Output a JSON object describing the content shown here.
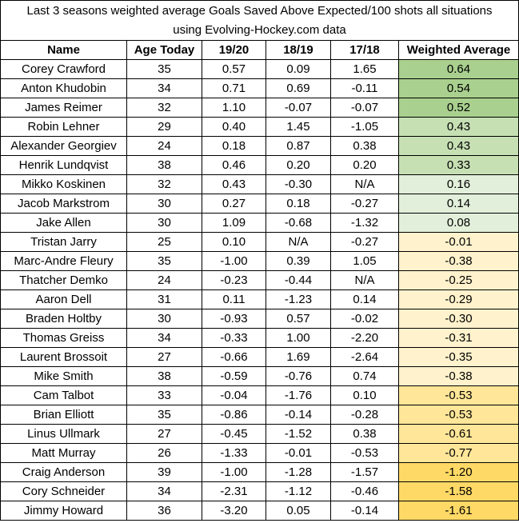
{
  "title": {
    "line1": "Last 3 seasons weighted average Goals Saved Above Expected/100 shots all situations",
    "line2": "using Evolving-Hockey.com data"
  },
  "columns": [
    "Name",
    "Age Today",
    "19/20",
    "18/19",
    "17/18",
    "Weighted Average"
  ],
  "colors": {
    "green_strong": "#a9d08e",
    "green_mid": "#c6e0b4",
    "green_light": "#e2efda",
    "yellow_light": "#fff2cc",
    "yellow_mid": "#ffe699",
    "yellow_strong": "#ffd966"
  },
  "rows": [
    {
      "name": "Corey Crawford",
      "age": "35",
      "s1920": "0.57",
      "s1819": "0.09",
      "s1718": "1.65",
      "wavg": "0.64",
      "shade": "green_strong"
    },
    {
      "name": "Anton Khudobin",
      "age": "34",
      "s1920": "0.71",
      "s1819": "0.69",
      "s1718": "-0.11",
      "wavg": "0.54",
      "shade": "green_strong"
    },
    {
      "name": "James Reimer",
      "age": "32",
      "s1920": "1.10",
      "s1819": "-0.07",
      "s1718": "-0.07",
      "wavg": "0.52",
      "shade": "green_strong"
    },
    {
      "name": "Robin Lehner",
      "age": "29",
      "s1920": "0.40",
      "s1819": "1.45",
      "s1718": "-1.05",
      "wavg": "0.43",
      "shade": "green_mid"
    },
    {
      "name": "Alexander Georgiev",
      "age": "24",
      "s1920": "0.18",
      "s1819": "0.87",
      "s1718": "0.38",
      "wavg": "0.43",
      "shade": "green_mid"
    },
    {
      "name": "Henrik Lundqvist",
      "age": "38",
      "s1920": "0.46",
      "s1819": "0.20",
      "s1718": "0.20",
      "wavg": "0.33",
      "shade": "green_mid"
    },
    {
      "name": "Mikko Koskinen",
      "age": "32",
      "s1920": "0.43",
      "s1819": "-0.30",
      "s1718": "N/A",
      "wavg": "0.16",
      "shade": "green_light"
    },
    {
      "name": "Jacob Markstrom",
      "age": "30",
      "s1920": "0.27",
      "s1819": "0.18",
      "s1718": "-0.27",
      "wavg": "0.14",
      "shade": "green_light"
    },
    {
      "name": "Jake Allen",
      "age": "30",
      "s1920": "1.09",
      "s1819": "-0.68",
      "s1718": "-1.32",
      "wavg": "0.08",
      "shade": "green_light"
    },
    {
      "name": "Tristan Jarry",
      "age": "25",
      "s1920": "0.10",
      "s1819": "N/A",
      "s1718": "-0.27",
      "wavg": "-0.01",
      "shade": "yellow_light"
    },
    {
      "name": "Marc-Andre Fleury",
      "age": "35",
      "s1920": "-1.00",
      "s1819": "0.39",
      "s1718": "1.05",
      "wavg": "-0.38",
      "shade": "yellow_light"
    },
    {
      "name": "Thatcher Demko",
      "age": "24",
      "s1920": "-0.23",
      "s1819": "-0.44",
      "s1718": "N/A",
      "wavg": "-0.25",
      "shade": "yellow_light"
    },
    {
      "name": "Aaron Dell",
      "age": "31",
      "s1920": "0.11",
      "s1819": "-1.23",
      "s1718": "0.14",
      "wavg": "-0.29",
      "shade": "yellow_light"
    },
    {
      "name": "Braden Holtby",
      "age": "30",
      "s1920": "-0.93",
      "s1819": "0.57",
      "s1718": "-0.02",
      "wavg": "-0.30",
      "shade": "yellow_light"
    },
    {
      "name": "Thomas Greiss",
      "age": "34",
      "s1920": "-0.33",
      "s1819": "1.00",
      "s1718": "-2.20",
      "wavg": "-0.31",
      "shade": "yellow_light"
    },
    {
      "name": "Laurent Brossoit",
      "age": "27",
      "s1920": "-0.66",
      "s1819": "1.69",
      "s1718": "-2.64",
      "wavg": "-0.35",
      "shade": "yellow_light"
    },
    {
      "name": "Mike Smith",
      "age": "38",
      "s1920": "-0.59",
      "s1819": "-0.76",
      "s1718": "0.74",
      "wavg": "-0.38",
      "shade": "yellow_light"
    },
    {
      "name": "Cam Talbot",
      "age": "33",
      "s1920": "-0.04",
      "s1819": "-1.76",
      "s1718": "0.10",
      "wavg": "-0.53",
      "shade": "yellow_mid"
    },
    {
      "name": "Brian Elliott",
      "age": "35",
      "s1920": "-0.86",
      "s1819": "-0.14",
      "s1718": "-0.28",
      "wavg": "-0.53",
      "shade": "yellow_mid"
    },
    {
      "name": "Linus Ullmark",
      "age": "27",
      "s1920": "-0.45",
      "s1819": "-1.52",
      "s1718": "0.38",
      "wavg": "-0.61",
      "shade": "yellow_mid"
    },
    {
      "name": "Matt Murray",
      "age": "26",
      "s1920": "-1.33",
      "s1819": "-0.01",
      "s1718": "-0.53",
      "wavg": "-0.77",
      "shade": "yellow_mid"
    },
    {
      "name": "Craig Anderson",
      "age": "39",
      "s1920": "-1.00",
      "s1819": "-1.28",
      "s1718": "-1.57",
      "wavg": "-1.20",
      "shade": "yellow_strong"
    },
    {
      "name": "Cory Schneider",
      "age": "34",
      "s1920": "-2.31",
      "s1819": "-1.12",
      "s1718": "-0.46",
      "wavg": "-1.58",
      "shade": "yellow_strong"
    },
    {
      "name": "Jimmy Howard",
      "age": "36",
      "s1920": "-3.20",
      "s1819": "0.05",
      "s1718": "-0.14",
      "wavg": "-1.61",
      "shade": "yellow_strong"
    }
  ]
}
